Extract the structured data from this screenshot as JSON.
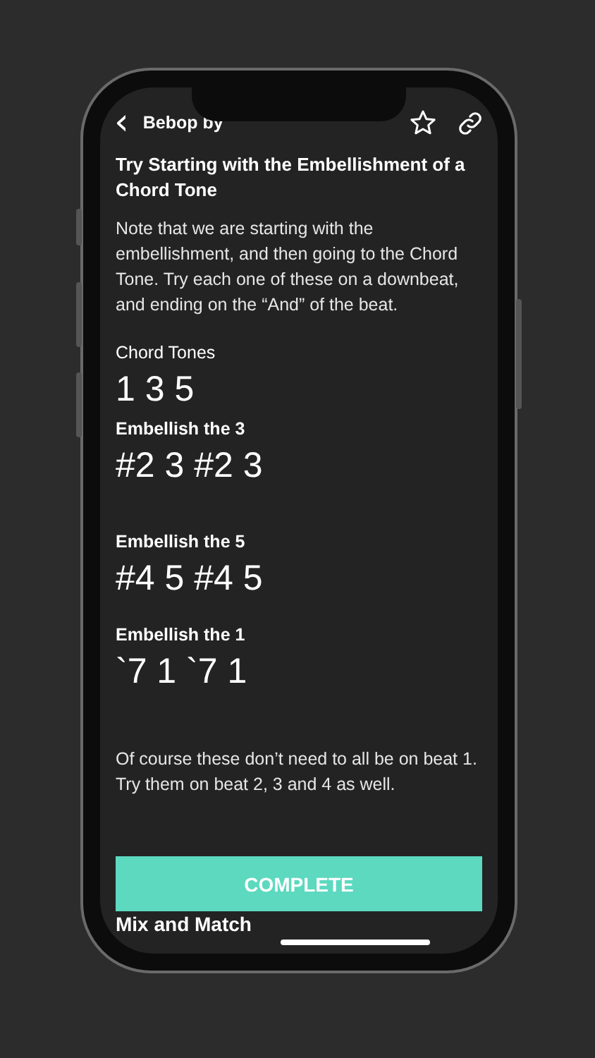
{
  "header": {
    "back": "‹",
    "title": "Bebop by"
  },
  "blocks": [
    {
      "kind": "heading",
      "text": "Try Starting with the Embellishment of a Chord Tone"
    },
    {
      "kind": "paragraph",
      "text": "Note that we are starting with the embellishment, and then going to the Chord Tone. Try each one of these on a downbeat, and ending on the “And” of the beat."
    },
    {
      "kind": "label",
      "text": "Chord Tones"
    },
    {
      "kind": "notes",
      "text": "1 3 5"
    },
    {
      "kind": "subheading",
      "text": "Embellish the 3"
    },
    {
      "kind": "notes",
      "text": "#2 3 #2 3"
    },
    {
      "kind": "subheading",
      "text": "Embellish the 5"
    },
    {
      "kind": "notes",
      "text": "#4 5 #4 5"
    },
    {
      "kind": "subheading",
      "text": "Embellish the 1"
    },
    {
      "kind": "notes",
      "text": "`7 1 `7 1"
    },
    {
      "kind": "paragraph",
      "text": "Of course these don’t need to all be on beat 1. Try them on beat 2, 3 and 4 as well."
    }
  ],
  "button": "COMPLETE",
  "next_heading": "Mix and Match"
}
